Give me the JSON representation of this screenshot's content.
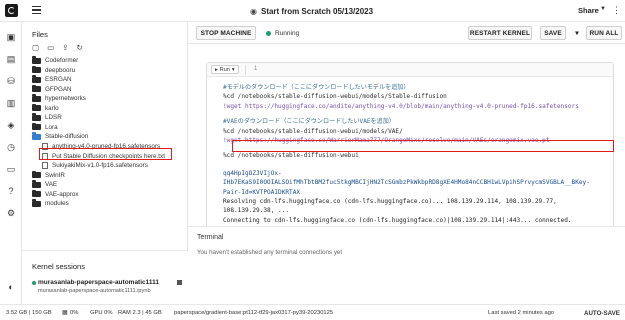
{
  "header": {
    "title": "Start from Scratch 05/13/2023",
    "share_label": "Share"
  },
  "files": {
    "title": "Files",
    "items": [
      {
        "label": "Codeformer",
        "type": "folder"
      },
      {
        "label": "deepbooru",
        "type": "folder"
      },
      {
        "label": "ESRGAN",
        "type": "folder"
      },
      {
        "label": "GFPGAN",
        "type": "folder"
      },
      {
        "label": "hypernetworks",
        "type": "folder"
      },
      {
        "label": "karlo",
        "type": "folder"
      },
      {
        "label": "LDSR",
        "type": "folder"
      },
      {
        "label": "Lora",
        "type": "folder"
      },
      {
        "label": "Stable-diffusion",
        "type": "folder-open"
      },
      {
        "label": "anything-v4.0-pruned-fp16.safetensors",
        "type": "file"
      },
      {
        "label": "Put Stable Diffusion checkpoints here.txt",
        "type": "file"
      },
      {
        "label": "SukiyakiMix-v1.0-fp16.safetensors",
        "type": "file"
      },
      {
        "label": "SwinIR",
        "type": "folder"
      },
      {
        "label": "VAE",
        "type": "folder"
      },
      {
        "label": "VAE-approx",
        "type": "folder"
      },
      {
        "label": "modules",
        "type": "folder"
      }
    ]
  },
  "kernel": {
    "title": "Kernel sessions",
    "name": "murasanlab-paperspace-automatic1111",
    "subtitle": "murasanlab-paperspace-automatic1111.ipynb"
  },
  "toolbar": {
    "stop_label": "STOP MACHINE",
    "status": "Running",
    "restart_label": "RESTART KERNEL",
    "save_label": "SAVE",
    "run_all_label": "RUN ALL"
  },
  "cell": {
    "run_label": "Run",
    "number": "1",
    "code": [
      {
        "text": "#モデルのダウンロード（ここにダウンロードしたいモデルを追加）",
        "cls": "c-comment"
      },
      {
        "text": "%cd /notebooks/stable-diffusion-webui/models/Stable-diffusion",
        "cls": "c-line"
      },
      {
        "text": "!wget https://huggingface.co/andite/anything-v4.0/blob/main/anything-v4.0-pruned-fp16.safetensors",
        "cls": "c-url"
      },
      {
        "text": "",
        "cls": "c-gap"
      },
      {
        "text": "#VAEのダウンロード（ここにダウンロードしたいVAEを追加）",
        "cls": "c-comment"
      },
      {
        "text": "%cd /notebooks/stable-diffusion-webui/models/VAE/",
        "cls": "c-line"
      },
      {
        "text": "!wget https://huggingface.co/WarriorMama777/OrangeMixs/resolve/main/VAEs/orangemix.vae.pt",
        "cls": "c-url"
      },
      {
        "text": "",
        "cls": "c-gap"
      },
      {
        "text": "%cd /notebooks/stable-diffusion-webui",
        "cls": "c-line"
      }
    ],
    "output": [
      {
        "text": "qq4HpIgOZJVIjOx-",
        "cls": ""
      },
      {
        "text": "IHb7EKaS9I0OOIALSOifMhTbtBM2fuc5tkgMBCIjHN2TcSGmbzPkWkbpRD8gXE4HMo84nCCBH1wLVpihSPrvycmSVGBLA__BKey-",
        "cls": ""
      },
      {
        "text": "Pair-Id=KVTPOAIDKRTAX",
        "cls": ""
      },
      {
        "text": "Resolving cdn-lfs.huggingface.co (cdn-lfs.huggingface.co)... 108.139.29.114, 108.139.29.77,",
        "cls": "o-plain"
      },
      {
        "text": "108.139.29.38, ...",
        "cls": "o-plain"
      },
      {
        "text": "Connecting to cdn-lfs.huggingface.co (cdn-lfs.huggingface.co)|108.139.29.114|:443... connected.",
        "cls": "o-plain"
      }
    ]
  },
  "terminal": {
    "title": "Terminal",
    "message": "You haven't established any terminal connections yet"
  },
  "statusbar": {
    "disk": "3.52 GB | 150 GB",
    "cpu": "0%",
    "gpu": "GPU 0%",
    "ram": "RAM 2.3 | 45 GB",
    "container": "paperspace/gradient-base:pt112-tf29-jax0317-py39-20230125",
    "last_saved": "Last saved 2 minutes ago",
    "autosave": "AUTO-SAVE"
  },
  "colors": {
    "accent_green": "#1aa06e",
    "highlight_red": "#e21b1b",
    "selected_blue": "#2f7fd3"
  }
}
